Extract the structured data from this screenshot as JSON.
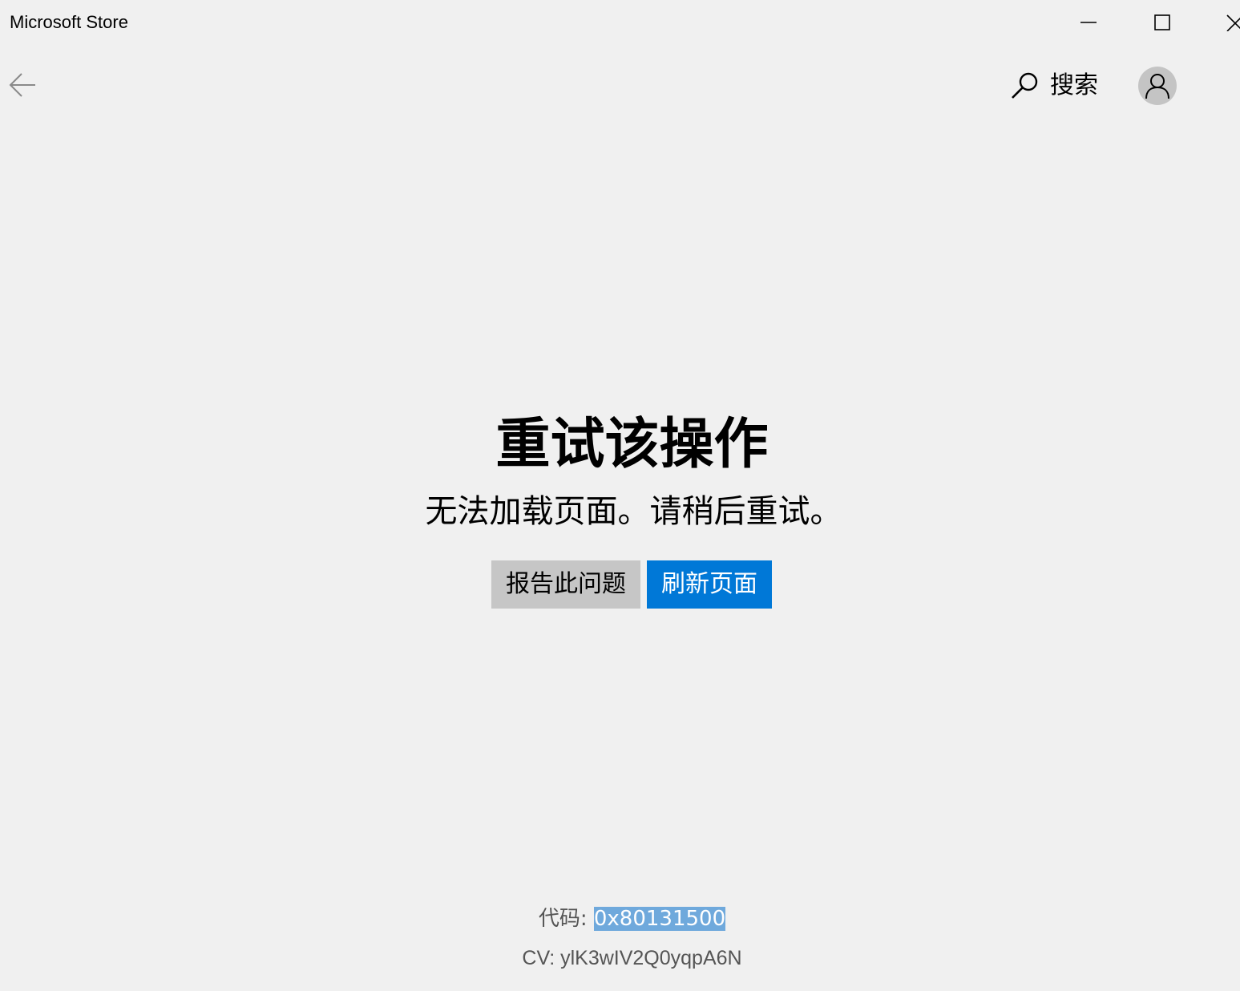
{
  "window": {
    "title": "Microsoft Store",
    "controls": {
      "minimize_icon": "minimize-icon",
      "maximize_icon": "maximize-icon",
      "close_icon": "close-icon"
    }
  },
  "nav": {
    "back_icon": "arrow-left-icon",
    "search_icon": "search-icon",
    "search_label": "搜索",
    "account_icon": "user-icon"
  },
  "error": {
    "title": "重试该操作",
    "message": "无法加载页面。请稍后重试。",
    "report_button": "报告此问题",
    "refresh_button": "刷新页面",
    "code_label": "代码: ",
    "code_value": "0x80131500",
    "cv_text": "CV: ylK3wIV2Q0yqpA6N"
  },
  "colors": {
    "background": "#f0f0f0",
    "accent": "#0078d7",
    "secondary_button": "#c6c6c6",
    "selection": "#6fa9dc",
    "muted_text": "#555555"
  }
}
